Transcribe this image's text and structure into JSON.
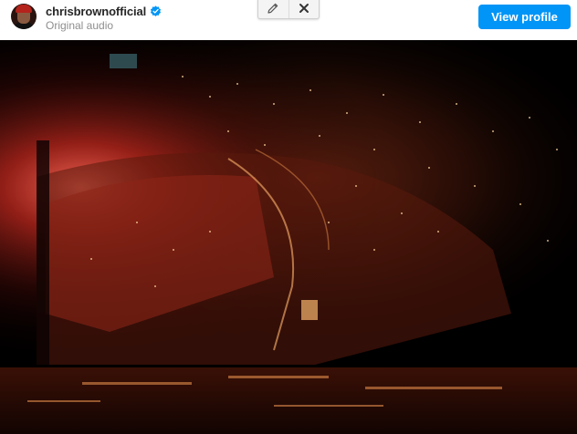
{
  "post_header": {
    "username": "chrisbrownofficial",
    "verified": true,
    "audio_label": "Original audio",
    "view_profile_label": "View profile"
  },
  "edit_toolbar": {
    "icons": [
      "pencil-icon",
      "close-icon"
    ]
  },
  "media": {
    "type": "video",
    "subject": "concert arena crowd at night"
  },
  "colors": {
    "accent": "#0095f6",
    "username": "#262626",
    "secondary_text": "#8e8e8e",
    "verified_badge": "#0095f6"
  }
}
